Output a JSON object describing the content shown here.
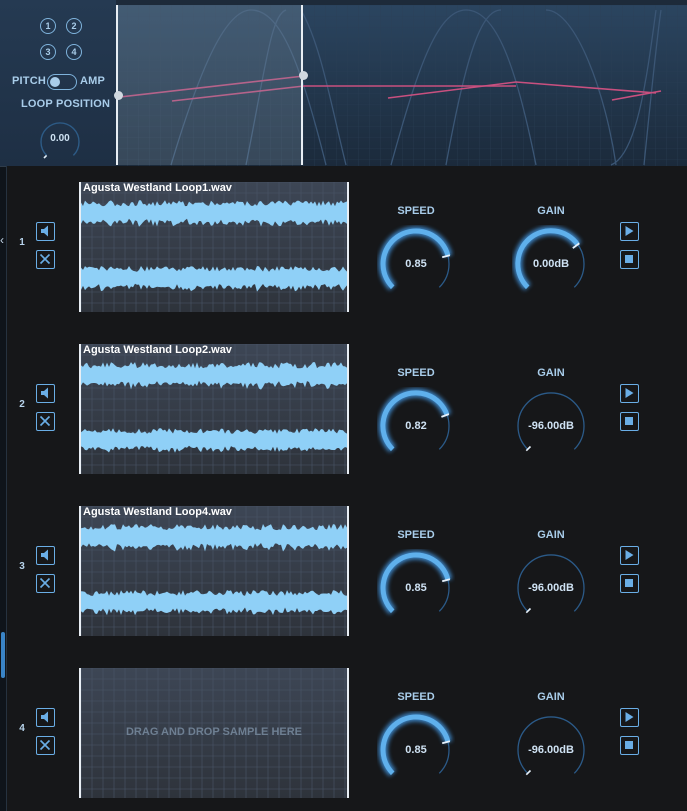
{
  "header": {
    "presets": [
      "1",
      "2",
      "3",
      "4"
    ],
    "pitch_label": "PITCH",
    "amp_label": "AMP",
    "loop_position_label": "LOOP POSITION",
    "loop_position_value": "0.00"
  },
  "rows": [
    {
      "number": "1",
      "filename": "Agusta Westland Loop1.wav",
      "speed_label": "SPEED",
      "speed_value": "0.85",
      "speed_level": 0.78,
      "gain_label": "GAIN",
      "gain_value": "0.00dB",
      "gain_level": 0.7,
      "loaded": true
    },
    {
      "number": "2",
      "filename": "Agusta Westland Loop2.wav",
      "speed_label": "SPEED",
      "speed_value": "0.82",
      "speed_level": 0.76,
      "gain_label": "GAIN",
      "gain_value": "-96.00dB",
      "gain_level": 0.0,
      "loaded": true
    },
    {
      "number": "3",
      "filename": "Agusta Westland Loop4.wav",
      "speed_label": "SPEED",
      "speed_value": "0.85",
      "speed_level": 0.78,
      "gain_label": "GAIN",
      "gain_value": "-96.00dB",
      "gain_level": 0.0,
      "loaded": true
    },
    {
      "number": "4",
      "filename": "",
      "drop_text": "DRAG AND DROP SAMPLE HERE",
      "speed_label": "SPEED",
      "speed_value": "0.85",
      "speed_level": 0.78,
      "gain_label": "GAIN",
      "gain_value": "-96.00dB",
      "gain_level": 0.0,
      "loaded": false
    }
  ],
  "colors": {
    "accent": "#5fb0ec",
    "waveform": "#8fd0f7",
    "curve": "#c9507f",
    "panel": "#161719"
  }
}
